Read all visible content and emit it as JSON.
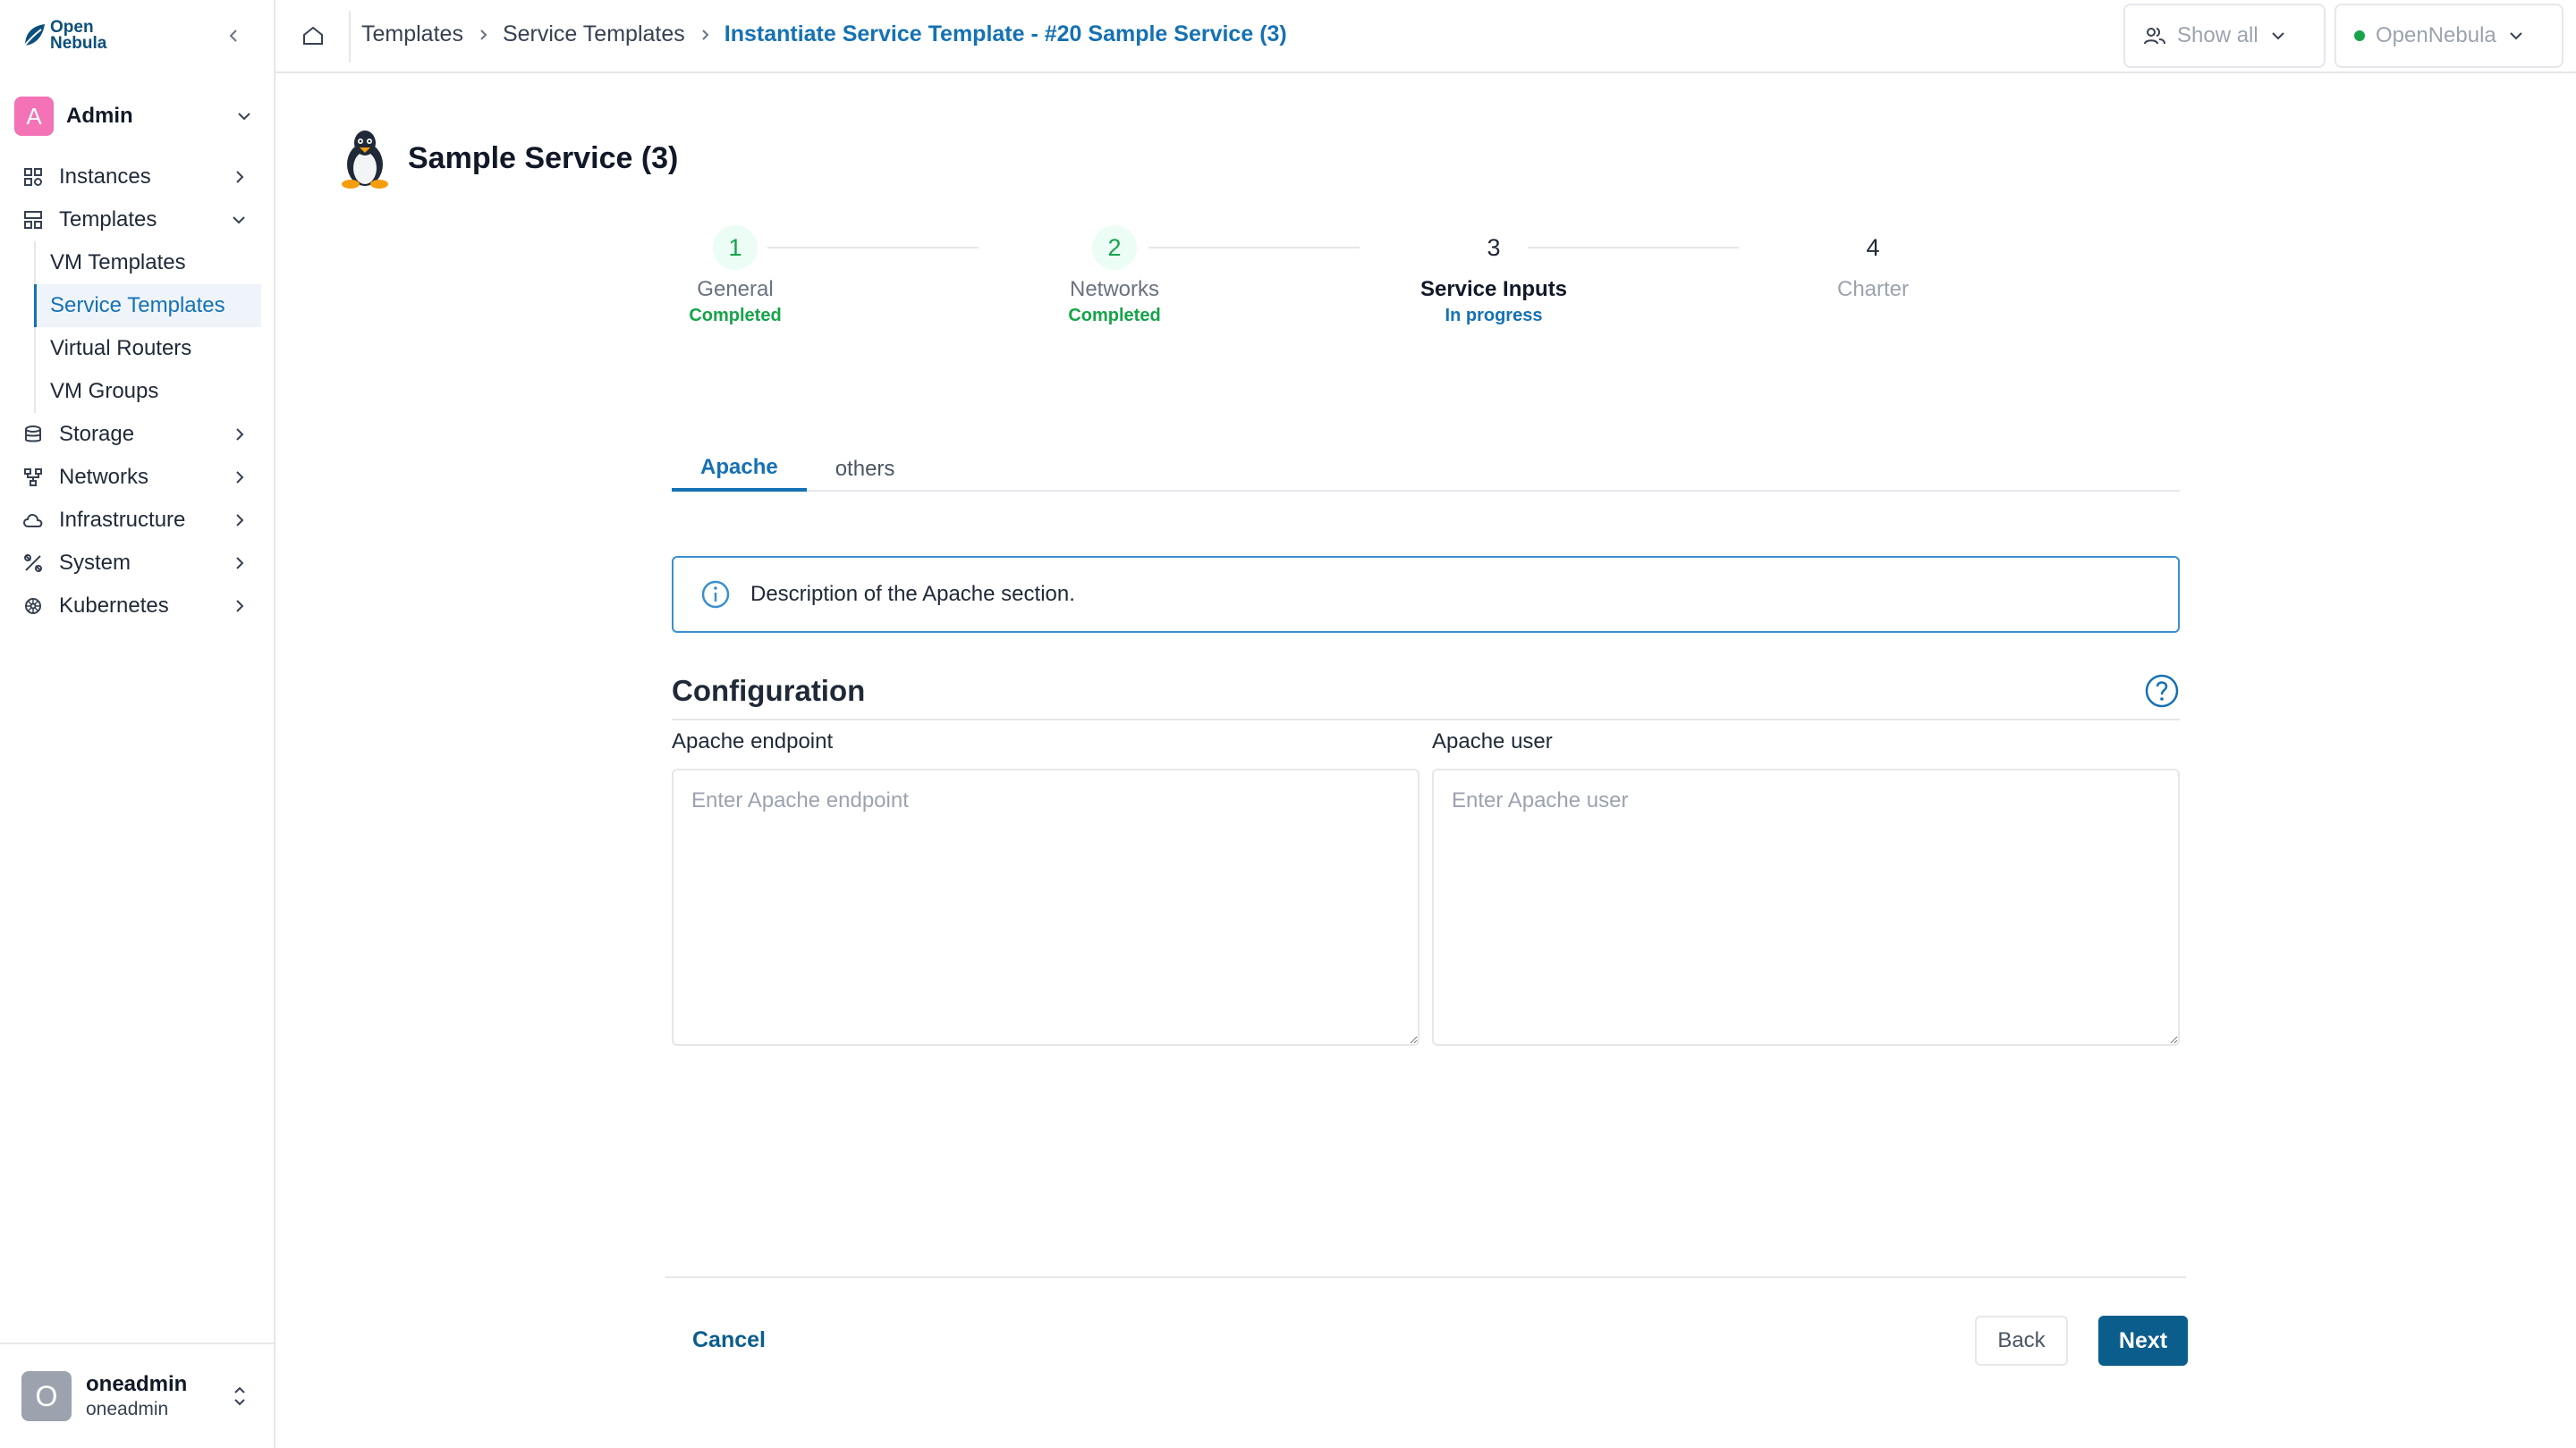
{
  "brand": {
    "line1": "Open",
    "line2": "Nebula"
  },
  "sidebar": {
    "group": {
      "initial": "A",
      "name": "Admin"
    },
    "nav": [
      {
        "label": "Instances",
        "icon": "grid-icon"
      },
      {
        "label": "Templates",
        "icon": "templates-icon",
        "expanded": true,
        "children": [
          "VM Templates",
          "Service Templates",
          "Virtual Routers",
          "VM Groups"
        ]
      },
      {
        "label": "Storage",
        "icon": "database-icon"
      },
      {
        "label": "Networks",
        "icon": "network-icon"
      },
      {
        "label": "Infrastructure",
        "icon": "cloud-icon"
      },
      {
        "label": "System",
        "icon": "tools-icon"
      },
      {
        "label": "Kubernetes",
        "icon": "helm-icon"
      }
    ],
    "active_child": "Service Templates",
    "user": {
      "initial": "O",
      "name": "oneadmin",
      "group": "oneadmin"
    }
  },
  "topbar": {
    "breadcrumbs": [
      "Templates",
      "Service Templates",
      "Instantiate Service Template - #20 Sample Service (3)"
    ],
    "group_filter": "Show all",
    "zone": "OpenNebula"
  },
  "page": {
    "title": "Sample Service (3)"
  },
  "stepper": [
    {
      "num": "1",
      "title": "General",
      "status": "Completed",
      "state": "done"
    },
    {
      "num": "2",
      "title": "Networks",
      "status": "Completed",
      "state": "done"
    },
    {
      "num": "3",
      "title": "Service Inputs",
      "status": "In progress",
      "state": "active"
    },
    {
      "num": "4",
      "title": "Charter",
      "status": "",
      "state": "pending"
    }
  ],
  "tabs": [
    {
      "label": "Apache",
      "active": true
    },
    {
      "label": "others",
      "active": false
    }
  ],
  "info": {
    "text": "Description of the Apache section."
  },
  "section": {
    "title": "Configuration"
  },
  "fields": [
    {
      "label": "Apache endpoint",
      "placeholder": "Enter Apache endpoint",
      "value": ""
    },
    {
      "label": "Apache user",
      "placeholder": "Enter Apache user",
      "value": ""
    }
  ],
  "actions": {
    "cancel": "Cancel",
    "back": "Back",
    "next": "Next"
  },
  "colors": {
    "accent": "#1571b4",
    "primary_button": "#0b5d8c",
    "success": "#16a34a",
    "avatar_group": "#f472b6"
  }
}
